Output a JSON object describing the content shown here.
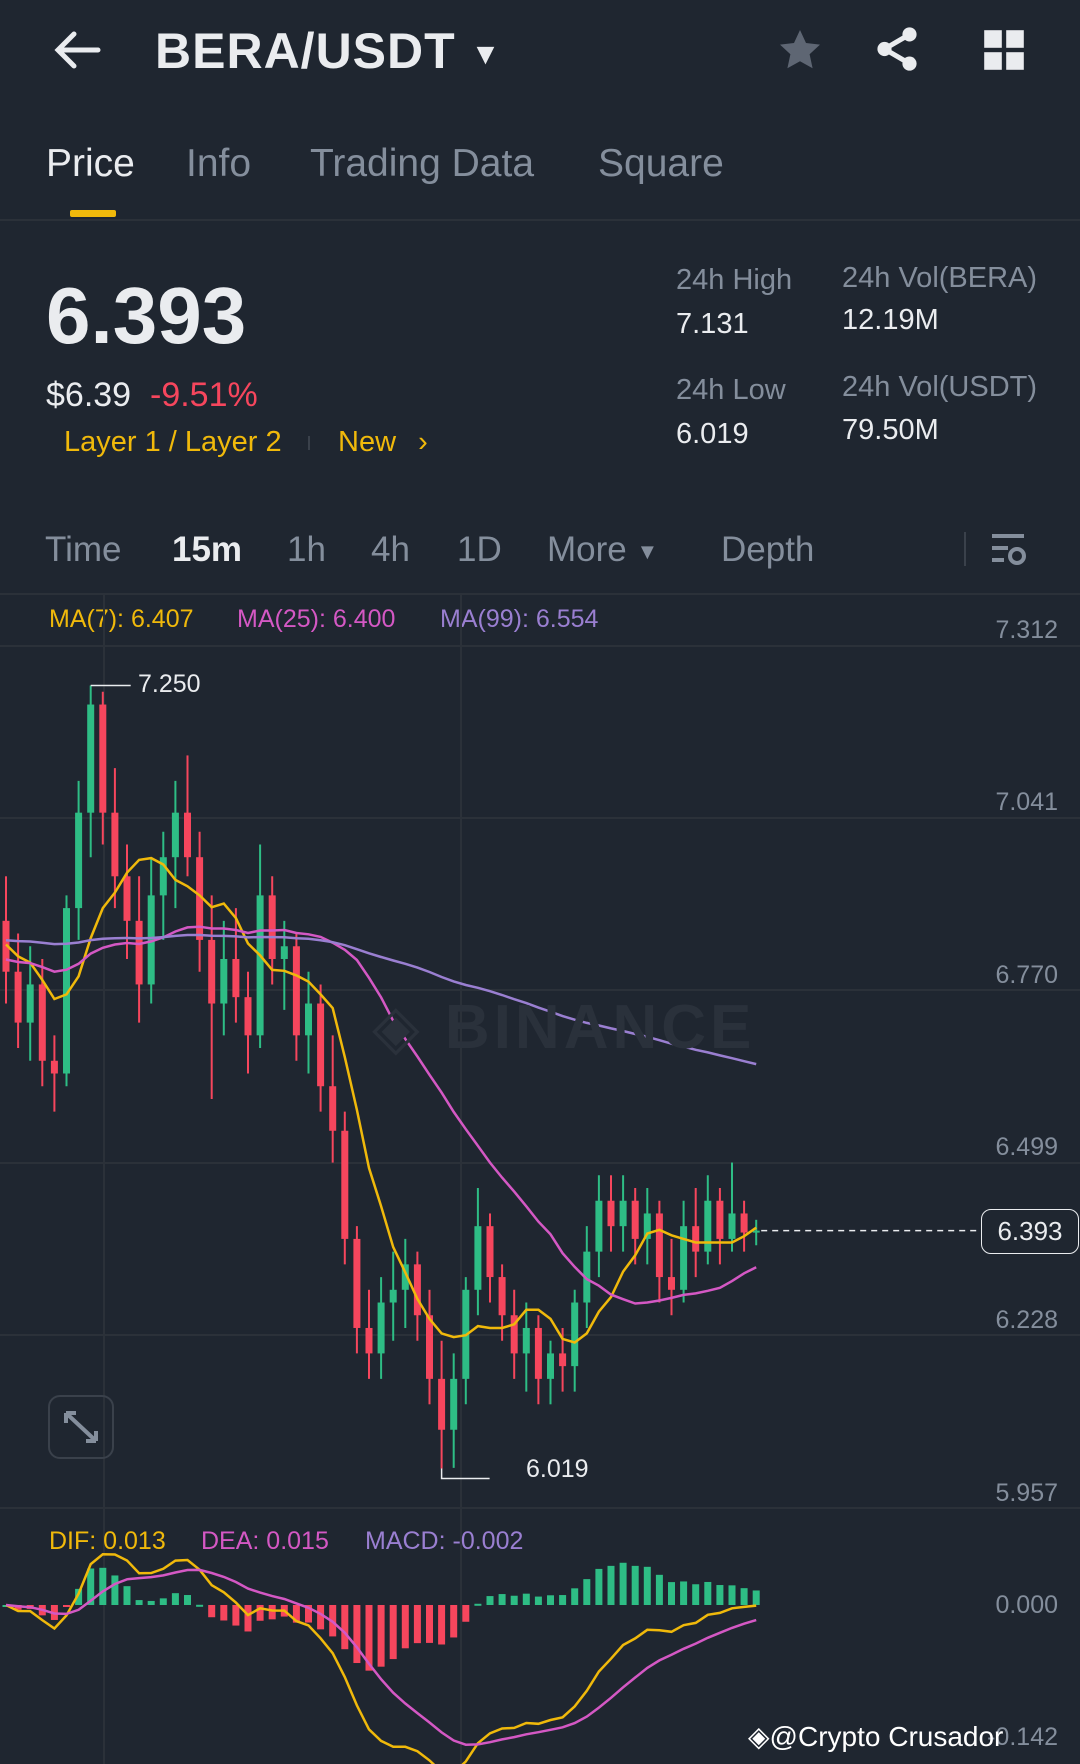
{
  "header": {
    "title": "BERA/USDT",
    "back_icon": "arrow-left-icon",
    "star_icon": "star-icon",
    "share_icon": "share-icon",
    "grid_icon": "grid-icon"
  },
  "tabs": [
    {
      "label": "Price"
    },
    {
      "label": "Info"
    },
    {
      "label": "Trading Data"
    },
    {
      "label": "Square"
    }
  ],
  "summary": {
    "price": "6.393",
    "usd": "$6.39",
    "change": "-9.51%",
    "tags": [
      "Layer 1 / Layer 2",
      "New"
    ],
    "stats": [
      {
        "label": "24h High",
        "value": "7.131"
      },
      {
        "label": "24h Vol(BERA)",
        "value": "12.19M"
      },
      {
        "label": "24h Low",
        "value": "6.019"
      },
      {
        "label": "24h Vol(USDT)",
        "value": "79.50M"
      }
    ]
  },
  "timeframes": [
    {
      "label": "Time"
    },
    {
      "label": "15m"
    },
    {
      "label": "1h"
    },
    {
      "label": "4h"
    },
    {
      "label": "1D"
    },
    {
      "label": "More"
    },
    {
      "label": "Depth"
    }
  ],
  "ma_legend": {
    "ma7": "MA(7): 6.407",
    "ma25": "MA(25): 6.400",
    "ma99": "MA(99): 6.554"
  },
  "macd_legend": {
    "dif": "DIF: 0.013",
    "dea": "DEA: 0.015",
    "macd": "MACD: -0.002"
  },
  "colors": {
    "up": "#2ebd85",
    "down": "#f6465d",
    "ma7": "#f0b90b",
    "ma25": "#d458c4",
    "ma99": "#9a7fd1",
    "accent": "#f0b90b"
  },
  "watermark": "BINANCE",
  "credit": "@Crypto Crusador",
  "chart_data": {
    "type": "candlestick",
    "price_axis": [
      "7.312",
      "7.041",
      "6.770",
      "6.499",
      "6.228",
      "5.957"
    ],
    "macd_axis": [
      "0.000",
      "-0.142"
    ],
    "high_label": "7.250",
    "low_label": "6.019",
    "current_price": "6.393",
    "ylim": [
      5.957,
      7.312
    ],
    "candles": [
      [
        6.88,
        6.95,
        6.75,
        6.8
      ],
      [
        6.8,
        6.86,
        6.68,
        6.72
      ],
      [
        6.72,
        6.84,
        6.66,
        6.78
      ],
      [
        6.78,
        6.82,
        6.62,
        6.66
      ],
      [
        6.66,
        6.7,
        6.58,
        6.64
      ],
      [
        6.64,
        6.92,
        6.62,
        6.9
      ],
      [
        6.9,
        7.1,
        6.85,
        7.05
      ],
      [
        7.05,
        7.25,
        6.98,
        7.22
      ],
      [
        7.22,
        7.24,
        7.0,
        7.05
      ],
      [
        7.05,
        7.12,
        6.9,
        6.95
      ],
      [
        6.95,
        7.0,
        6.82,
        6.88
      ],
      [
        6.88,
        6.95,
        6.72,
        6.78
      ],
      [
        6.78,
        6.98,
        6.75,
        6.92
      ],
      [
        6.92,
        7.02,
        6.85,
        6.98
      ],
      [
        6.98,
        7.1,
        6.9,
        7.05
      ],
      [
        7.05,
        7.14,
        6.95,
        6.98
      ],
      [
        6.98,
        7.02,
        6.8,
        6.85
      ],
      [
        6.85,
        6.92,
        6.6,
        6.75
      ],
      [
        6.75,
        6.88,
        6.7,
        6.82
      ],
      [
        6.82,
        6.9,
        6.72,
        6.76
      ],
      [
        6.76,
        6.8,
        6.64,
        6.7
      ],
      [
        6.7,
        7.0,
        6.68,
        6.92
      ],
      [
        6.92,
        6.95,
        6.78,
        6.82
      ],
      [
        6.82,
        6.88,
        6.74,
        6.84
      ],
      [
        6.84,
        6.86,
        6.66,
        6.7
      ],
      [
        6.7,
        6.8,
        6.64,
        6.75
      ],
      [
        6.75,
        6.78,
        6.58,
        6.62
      ],
      [
        6.62,
        6.7,
        6.5,
        6.55
      ],
      [
        6.55,
        6.58,
        6.34,
        6.38
      ],
      [
        6.38,
        6.4,
        6.2,
        6.24
      ],
      [
        6.24,
        6.3,
        6.16,
        6.2
      ],
      [
        6.2,
        6.32,
        6.16,
        6.28
      ],
      [
        6.28,
        6.36,
        6.22,
        6.3
      ],
      [
        6.3,
        6.38,
        6.24,
        6.34
      ],
      [
        6.34,
        6.36,
        6.22,
        6.26
      ],
      [
        6.26,
        6.3,
        6.12,
        6.16
      ],
      [
        6.16,
        6.22,
        6.019,
        6.08
      ],
      [
        6.08,
        6.2,
        6.02,
        6.16
      ],
      [
        6.16,
        6.32,
        6.12,
        6.3
      ],
      [
        6.3,
        6.46,
        6.26,
        6.4
      ],
      [
        6.4,
        6.42,
        6.28,
        6.32
      ],
      [
        6.32,
        6.34,
        6.22,
        6.26
      ],
      [
        6.26,
        6.3,
        6.16,
        6.2
      ],
      [
        6.2,
        6.28,
        6.14,
        6.24
      ],
      [
        6.24,
        6.26,
        6.12,
        6.16
      ],
      [
        6.16,
        6.22,
        6.12,
        6.2
      ],
      [
        6.2,
        6.24,
        6.14,
        6.18
      ],
      [
        6.18,
        6.3,
        6.14,
        6.28
      ],
      [
        6.28,
        6.4,
        6.24,
        6.36
      ],
      [
        6.36,
        6.48,
        6.32,
        6.44
      ],
      [
        6.44,
        6.48,
        6.36,
        6.4
      ],
      [
        6.4,
        6.48,
        6.36,
        6.44
      ],
      [
        6.44,
        6.46,
        6.34,
        6.38
      ],
      [
        6.38,
        6.46,
        6.34,
        6.42
      ],
      [
        6.42,
        6.44,
        6.28,
        6.32
      ],
      [
        6.32,
        6.38,
        6.26,
        6.3
      ],
      [
        6.3,
        6.44,
        6.28,
        6.4
      ],
      [
        6.4,
        6.46,
        6.32,
        6.36
      ],
      [
        6.36,
        6.48,
        6.34,
        6.44
      ],
      [
        6.44,
        6.46,
        6.34,
        6.38
      ],
      [
        6.38,
        6.5,
        6.36,
        6.42
      ],
      [
        6.42,
        6.44,
        6.36,
        6.39
      ],
      [
        6.39,
        6.41,
        6.37,
        6.393
      ]
    ]
  }
}
